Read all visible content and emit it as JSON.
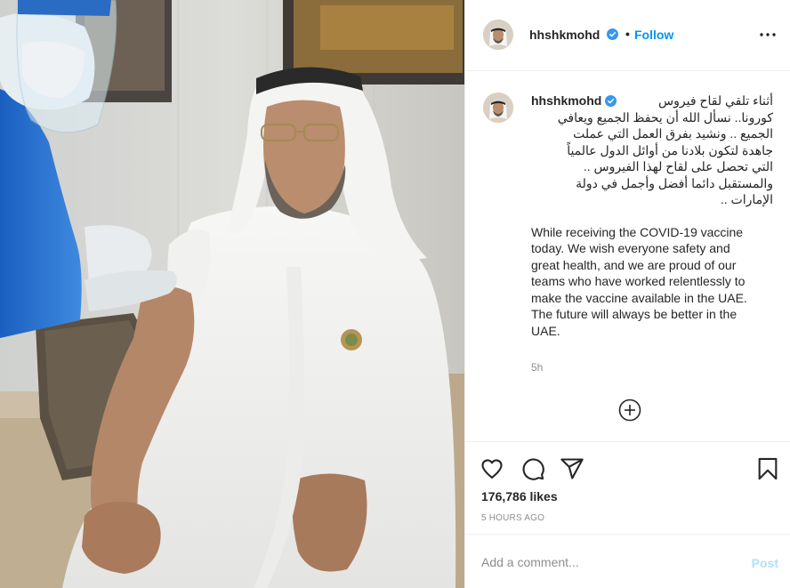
{
  "header": {
    "username": "hhshkmohd",
    "separator": "•",
    "follow_label": "Follow",
    "more_icon": "more-horizontal-icon"
  },
  "caption": {
    "username": "hhshkmohd",
    "arabic_first": "أثناء تلقي لقاح فيروس",
    "arabic_lines": [
      "كورونا.. نسأل الله أن يحفظ الجميع ويعافي",
      "الجميع .. ونشيد بفرق العمل التي عملت",
      "جاهدة لتكون بلادنا من أوائل الدول عالمياً",
      "التي تحصل على لقاح لهذا الفيروس ..",
      "والمستقبل دائما أفضل وأجمل في دولة",
      "الإمارات .."
    ],
    "english": [
      "While receiving the COVID-19 vaccine",
      "today. We wish everyone safety and",
      "great health, and we are proud of our",
      "teams who have worked relentlessly to",
      "make the vaccine available in the UAE.",
      "The future will always be better in the",
      "UAE."
    ],
    "time": "5h",
    "load_more_icon": "plus-circle-icon"
  },
  "actions": {
    "like_icon": "heart-icon",
    "comment_icon": "comment-icon",
    "share_icon": "send-icon",
    "save_icon": "bookmark-icon",
    "likes": "176,786 likes",
    "timestamp": "5 HOURS AGO"
  },
  "comment": {
    "placeholder": "Add a comment...",
    "post_label": "Post"
  },
  "colors": {
    "accent": "#0095f6",
    "post_disabled": "#b2dffc",
    "text": "#262626",
    "muted": "#8e8e8e",
    "verified": "#3897f0"
  }
}
